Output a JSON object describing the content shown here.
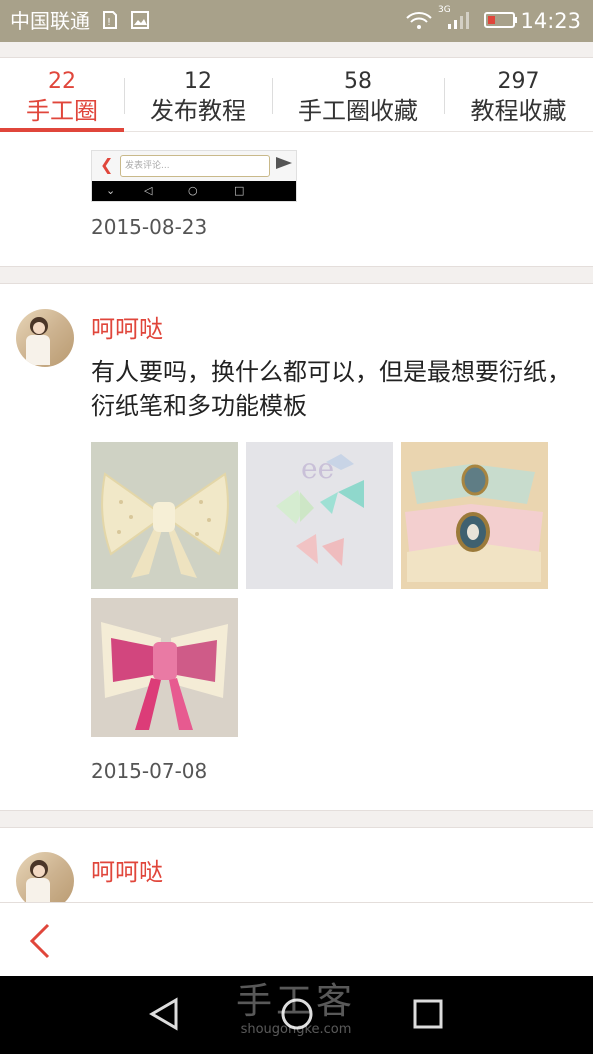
{
  "status_bar": {
    "carrier": "中国联通",
    "network": "3G",
    "time": "14:23"
  },
  "tabs": [
    {
      "count": "22",
      "label": "手工圈",
      "active": true
    },
    {
      "count": "12",
      "label": "发布教程",
      "active": false
    },
    {
      "count": "58",
      "label": "手工圈收藏",
      "active": false
    },
    {
      "count": "297",
      "label": "教程收藏",
      "active": false
    }
  ],
  "posts": [
    {
      "date": "2015-08-23",
      "mini_screenshot": {
        "placeholder": "发表评论..."
      }
    },
    {
      "username": "呵呵哒",
      "text": "有人要吗，换什么都可以，但是最想要衍纸，衍纸笔和多功能模板",
      "images": [
        "lace-bow-image",
        "satin-bows-image",
        "cameo-bows-image",
        "pink-ribbon-bow-image"
      ],
      "date": "2015-07-08"
    },
    {
      "username": "呵呵哒"
    }
  ],
  "watermark": {
    "title": "手工客",
    "url": "shougongke.com"
  },
  "colors": {
    "accent": "#e0463b",
    "status_bar": "#a8a18a"
  }
}
